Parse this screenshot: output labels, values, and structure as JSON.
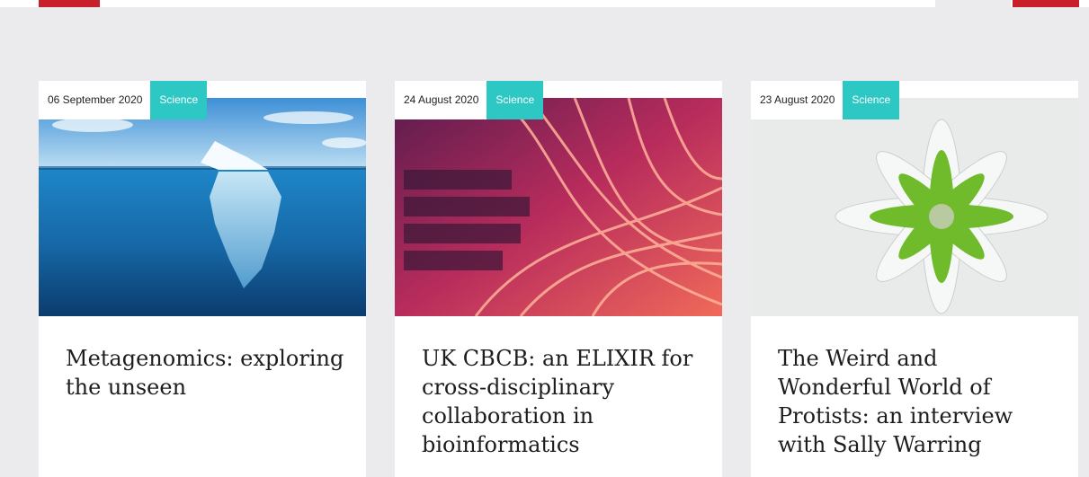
{
  "colors": {
    "accent_red": "#c8202b",
    "tag_teal": "#2ec8c4",
    "page_bg": "#ebebed"
  },
  "articles": [
    {
      "date": "06 September 2020",
      "category": "Science",
      "title": "Metagenomics: exploring the unseen",
      "image": "iceberg-image"
    },
    {
      "date": "24 August 2020",
      "category": "Science",
      "title": "UK CBCB: an ELIXIR for cross-disciplinary collaboration in bioinformatics",
      "image": "fiber-cables-image"
    },
    {
      "date": "23 August 2020",
      "category": "Science",
      "title": "The Weird and Wonderful World of Protists: an interview with Sally Warring",
      "image": "protist-micrograph-image"
    }
  ]
}
